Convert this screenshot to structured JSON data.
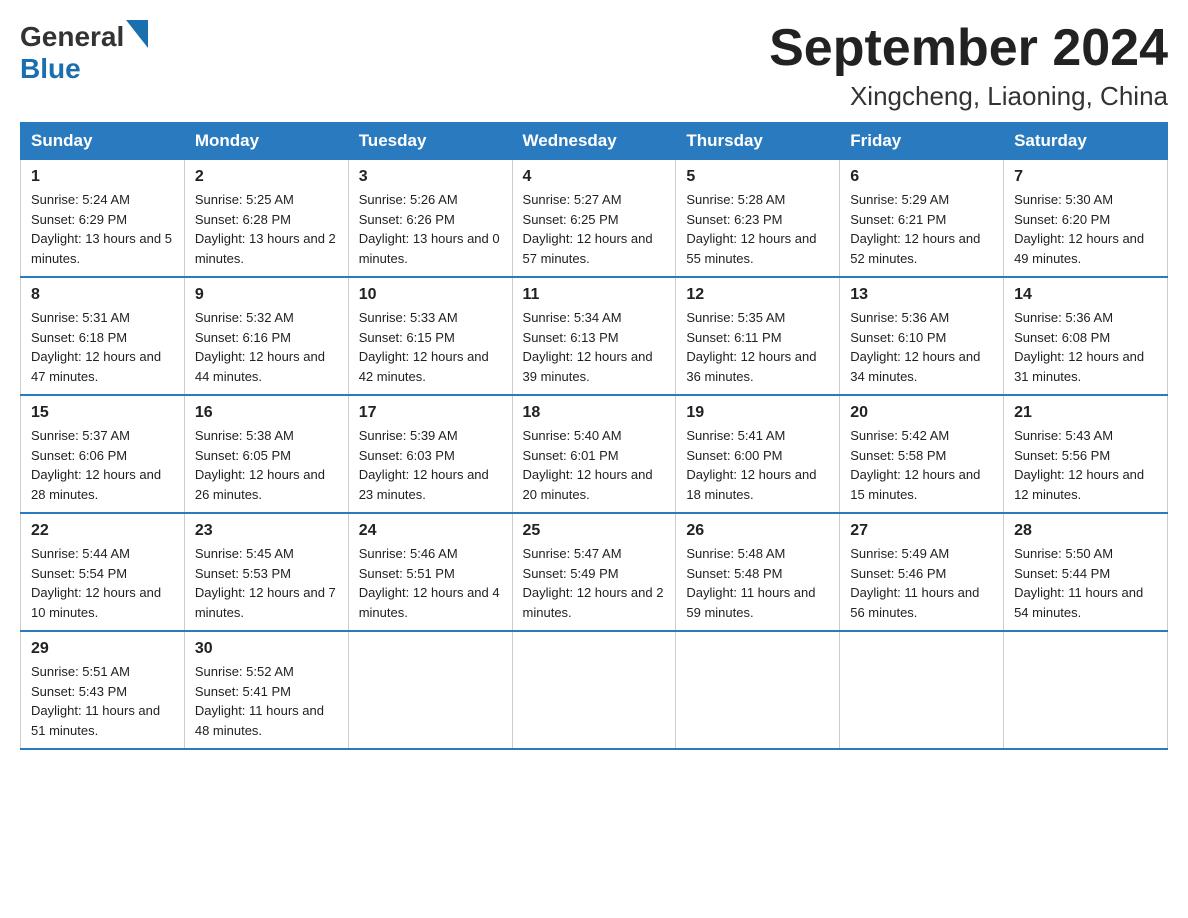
{
  "logo": {
    "general": "General",
    "blue": "Blue",
    "triangle": "▶"
  },
  "header": {
    "title": "September 2024",
    "subtitle": "Xingcheng, Liaoning, China"
  },
  "weekdays": [
    "Sunday",
    "Monday",
    "Tuesday",
    "Wednesday",
    "Thursday",
    "Friday",
    "Saturday"
  ],
  "weeks": [
    [
      {
        "day": "1",
        "sunrise": "5:24 AM",
        "sunset": "6:29 PM",
        "daylight": "13 hours and 5 minutes."
      },
      {
        "day": "2",
        "sunrise": "5:25 AM",
        "sunset": "6:28 PM",
        "daylight": "13 hours and 2 minutes."
      },
      {
        "day": "3",
        "sunrise": "5:26 AM",
        "sunset": "6:26 PM",
        "daylight": "13 hours and 0 minutes."
      },
      {
        "day": "4",
        "sunrise": "5:27 AM",
        "sunset": "6:25 PM",
        "daylight": "12 hours and 57 minutes."
      },
      {
        "day": "5",
        "sunrise": "5:28 AM",
        "sunset": "6:23 PM",
        "daylight": "12 hours and 55 minutes."
      },
      {
        "day": "6",
        "sunrise": "5:29 AM",
        "sunset": "6:21 PM",
        "daylight": "12 hours and 52 minutes."
      },
      {
        "day": "7",
        "sunrise": "5:30 AM",
        "sunset": "6:20 PM",
        "daylight": "12 hours and 49 minutes."
      }
    ],
    [
      {
        "day": "8",
        "sunrise": "5:31 AM",
        "sunset": "6:18 PM",
        "daylight": "12 hours and 47 minutes."
      },
      {
        "day": "9",
        "sunrise": "5:32 AM",
        "sunset": "6:16 PM",
        "daylight": "12 hours and 44 minutes."
      },
      {
        "day": "10",
        "sunrise": "5:33 AM",
        "sunset": "6:15 PM",
        "daylight": "12 hours and 42 minutes."
      },
      {
        "day": "11",
        "sunrise": "5:34 AM",
        "sunset": "6:13 PM",
        "daylight": "12 hours and 39 minutes."
      },
      {
        "day": "12",
        "sunrise": "5:35 AM",
        "sunset": "6:11 PM",
        "daylight": "12 hours and 36 minutes."
      },
      {
        "day": "13",
        "sunrise": "5:36 AM",
        "sunset": "6:10 PM",
        "daylight": "12 hours and 34 minutes."
      },
      {
        "day": "14",
        "sunrise": "5:36 AM",
        "sunset": "6:08 PM",
        "daylight": "12 hours and 31 minutes."
      }
    ],
    [
      {
        "day": "15",
        "sunrise": "5:37 AM",
        "sunset": "6:06 PM",
        "daylight": "12 hours and 28 minutes."
      },
      {
        "day": "16",
        "sunrise": "5:38 AM",
        "sunset": "6:05 PM",
        "daylight": "12 hours and 26 minutes."
      },
      {
        "day": "17",
        "sunrise": "5:39 AM",
        "sunset": "6:03 PM",
        "daylight": "12 hours and 23 minutes."
      },
      {
        "day": "18",
        "sunrise": "5:40 AM",
        "sunset": "6:01 PM",
        "daylight": "12 hours and 20 minutes."
      },
      {
        "day": "19",
        "sunrise": "5:41 AM",
        "sunset": "6:00 PM",
        "daylight": "12 hours and 18 minutes."
      },
      {
        "day": "20",
        "sunrise": "5:42 AM",
        "sunset": "5:58 PM",
        "daylight": "12 hours and 15 minutes."
      },
      {
        "day": "21",
        "sunrise": "5:43 AM",
        "sunset": "5:56 PM",
        "daylight": "12 hours and 12 minutes."
      }
    ],
    [
      {
        "day": "22",
        "sunrise": "5:44 AM",
        "sunset": "5:54 PM",
        "daylight": "12 hours and 10 minutes."
      },
      {
        "day": "23",
        "sunrise": "5:45 AM",
        "sunset": "5:53 PM",
        "daylight": "12 hours and 7 minutes."
      },
      {
        "day": "24",
        "sunrise": "5:46 AM",
        "sunset": "5:51 PM",
        "daylight": "12 hours and 4 minutes."
      },
      {
        "day": "25",
        "sunrise": "5:47 AM",
        "sunset": "5:49 PM",
        "daylight": "12 hours and 2 minutes."
      },
      {
        "day": "26",
        "sunrise": "5:48 AM",
        "sunset": "5:48 PM",
        "daylight": "11 hours and 59 minutes."
      },
      {
        "day": "27",
        "sunrise": "5:49 AM",
        "sunset": "5:46 PM",
        "daylight": "11 hours and 56 minutes."
      },
      {
        "day": "28",
        "sunrise": "5:50 AM",
        "sunset": "5:44 PM",
        "daylight": "11 hours and 54 minutes."
      }
    ],
    [
      {
        "day": "29",
        "sunrise": "5:51 AM",
        "sunset": "5:43 PM",
        "daylight": "11 hours and 51 minutes."
      },
      {
        "day": "30",
        "sunrise": "5:52 AM",
        "sunset": "5:41 PM",
        "daylight": "11 hours and 48 minutes."
      },
      null,
      null,
      null,
      null,
      null
    ]
  ],
  "labels": {
    "sunrise": "Sunrise:",
    "sunset": "Sunset:",
    "daylight": "Daylight:"
  }
}
